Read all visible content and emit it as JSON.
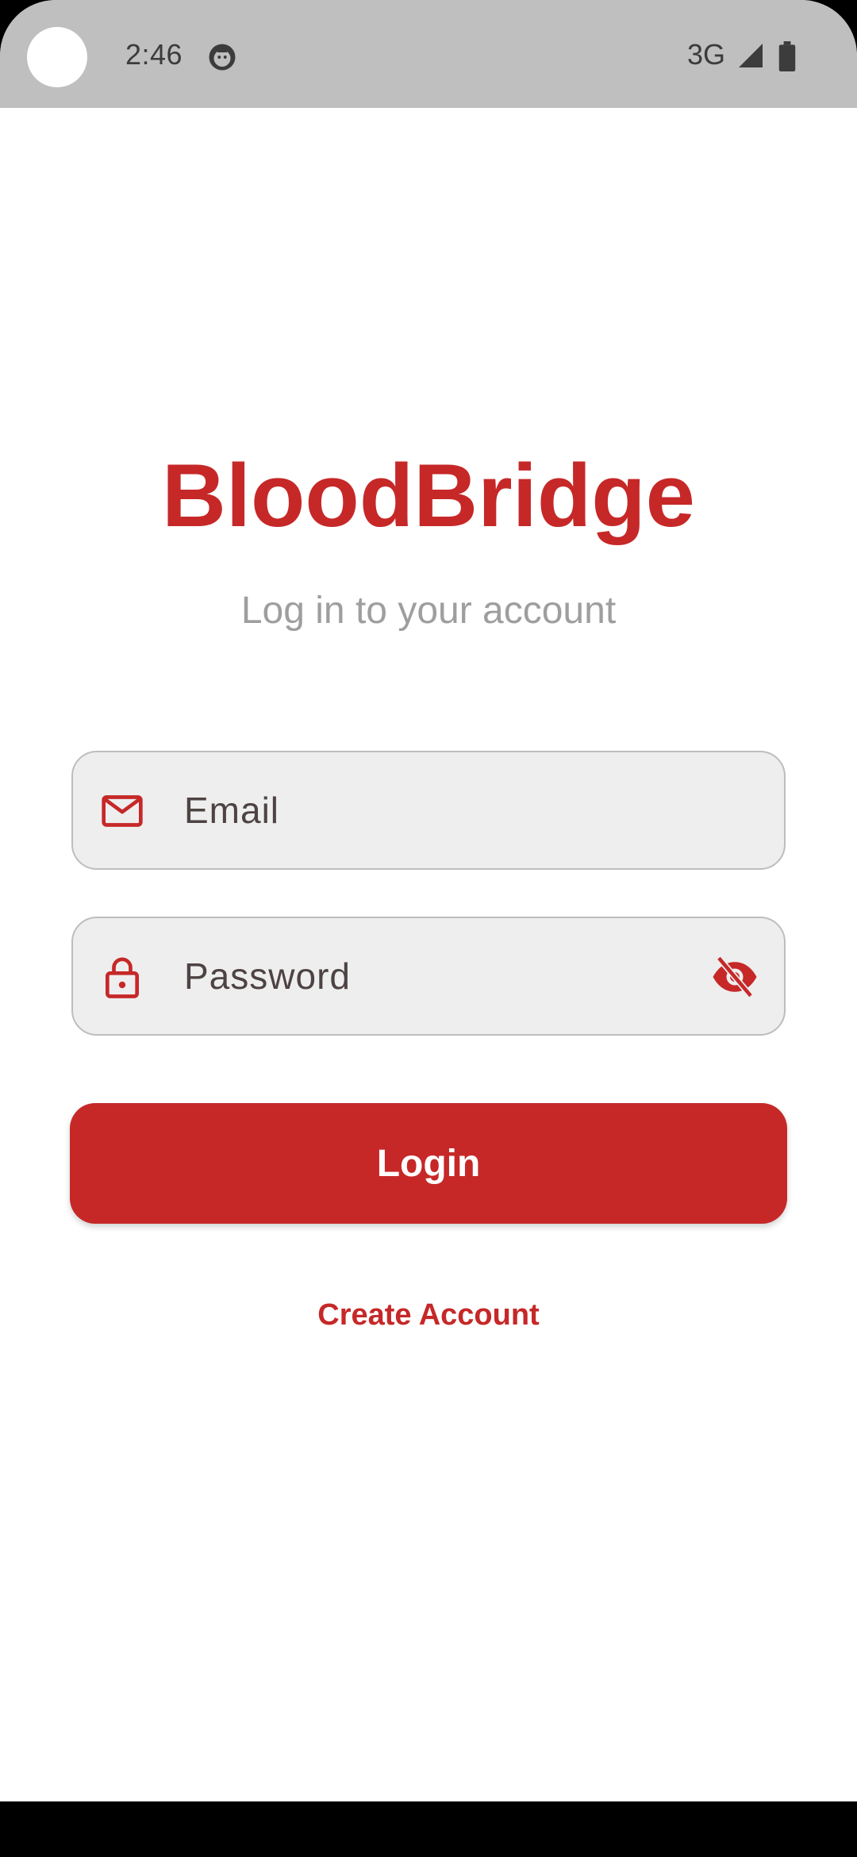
{
  "status_bar": {
    "time": "2:46",
    "network": "3G",
    "app_icon": "face-icon",
    "signal_icon": "cellular-signal-icon",
    "battery_icon": "battery-icon"
  },
  "app": {
    "title": "BloodBridge",
    "subtitle": "Log in to your account",
    "accent_color": "#c62828"
  },
  "form": {
    "email": {
      "placeholder": "Email",
      "value": "",
      "icon": "mail-icon"
    },
    "password": {
      "placeholder": "Password",
      "value": "",
      "icon": "lock-icon",
      "toggle_icon": "eye-off-icon"
    },
    "login_label": "Login",
    "create_account_label": "Create Account"
  }
}
